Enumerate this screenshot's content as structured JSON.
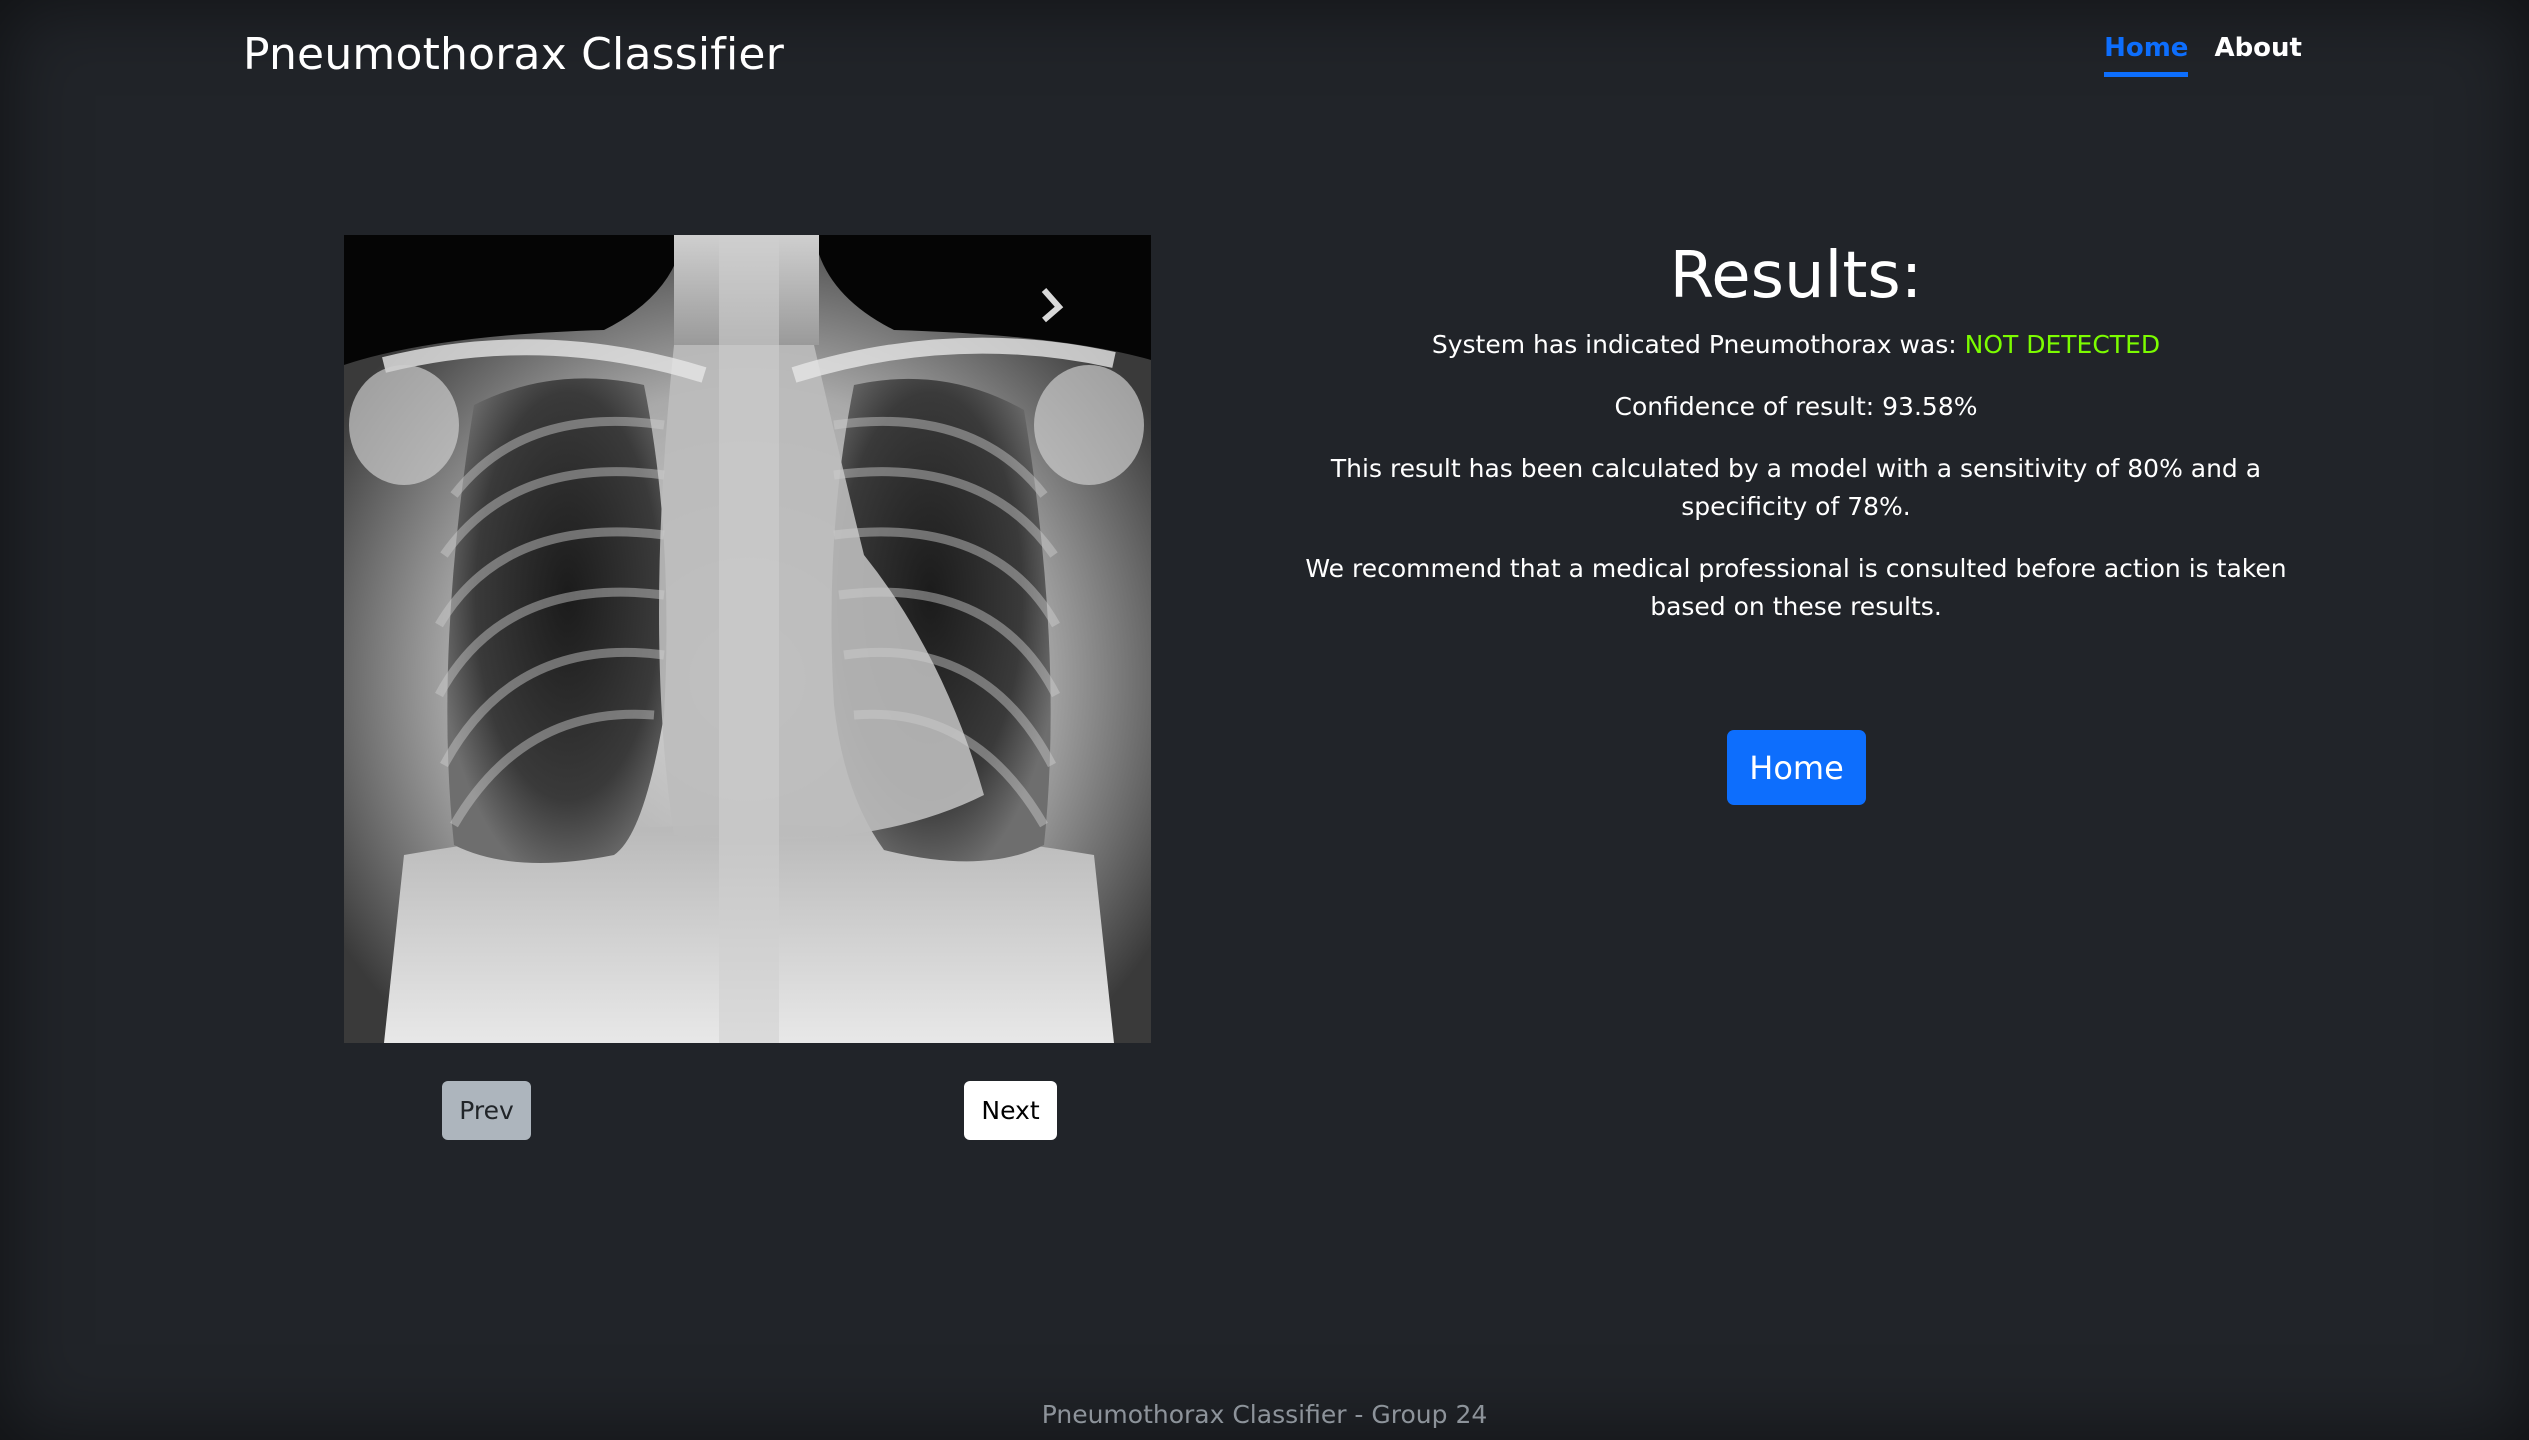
{
  "header": {
    "brand": "Pneumothorax Classifier",
    "nav": [
      {
        "label": "Home",
        "active": true
      },
      {
        "label": "About",
        "active": false
      }
    ]
  },
  "image_viewer": {
    "image": "chest-xray",
    "prev_label": "Prev",
    "next_label": "Next"
  },
  "results": {
    "heading": "Results:",
    "indication_prefix": "System has indicated Pneumothorax was: ",
    "indication_value": "NOT DETECTED",
    "confidence": "Confidence of result: 93.58%",
    "model_note": "This result has been calculated by a model with a sensitivity of 80% and a specificity of 78%.",
    "recommendation": "We recommend that a medical professional is consulted before action is taken based on these results.",
    "home_button": "Home"
  },
  "footer": {
    "text": "Pneumothorax Classifier - Group 24"
  },
  "colors": {
    "background": "#212429",
    "accent": "#0d6efd",
    "status_ok": "#7CFC00"
  }
}
